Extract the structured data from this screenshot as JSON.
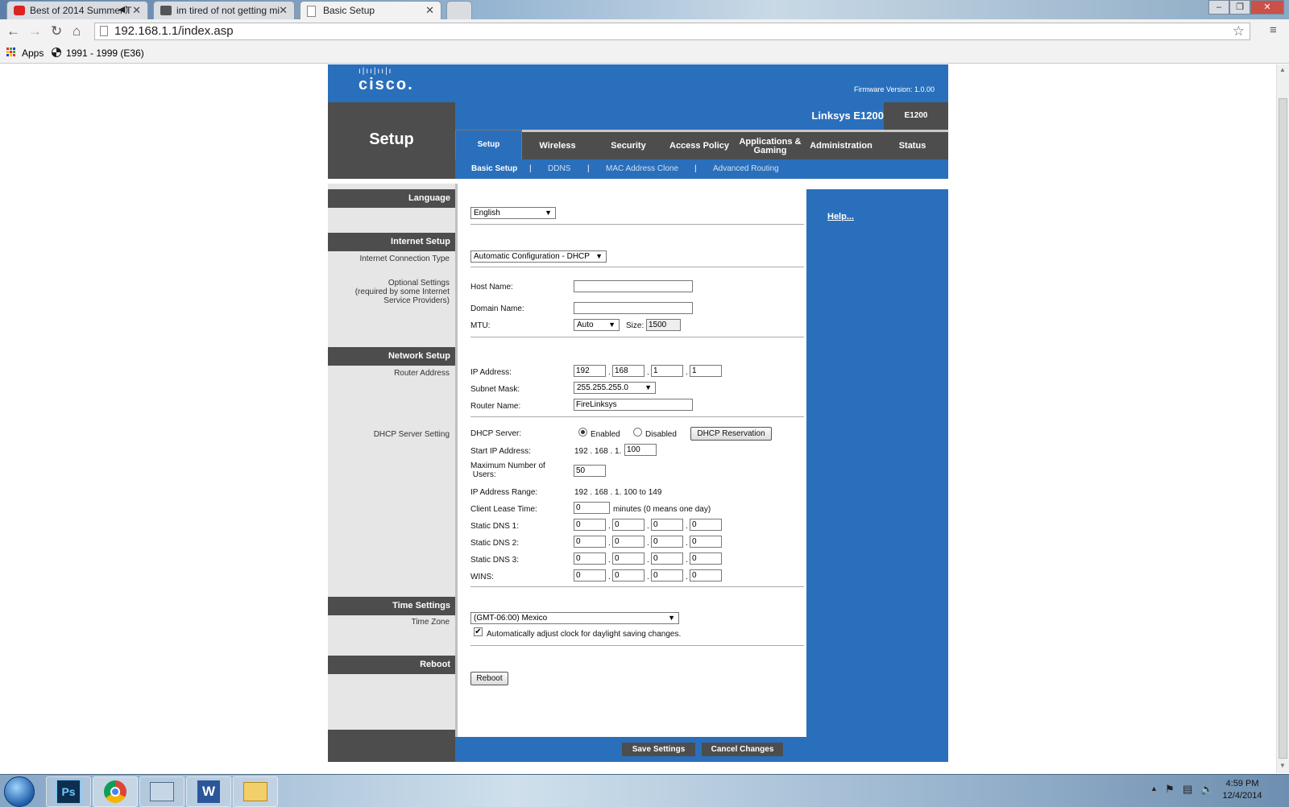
{
  "browser": {
    "tabs": [
      {
        "title": "Best of 2014 Summer T"
      },
      {
        "title": "im tired of not getting mi"
      },
      {
        "title": "Basic Setup"
      }
    ],
    "url": "192.168.1.1/index.asp",
    "bookmarks": [
      {
        "label": "Apps"
      },
      {
        "label": "1991 - 1999 (E36)"
      }
    ]
  },
  "router": {
    "brand": "cisco.",
    "firmware": "Firmware Version: 1.0.00",
    "page_title": "Setup",
    "model_name": "Linksys E1200",
    "model_code": "E1200",
    "main_nav": [
      {
        "label": "Setup"
      },
      {
        "label": "Wireless"
      },
      {
        "label": "Security"
      },
      {
        "label": "Access Policy"
      },
      {
        "label": "Applications & Gaming"
      },
      {
        "label": "Administration"
      },
      {
        "label": "Status"
      }
    ],
    "sub_nav": [
      {
        "label": "Basic Setup"
      },
      {
        "label": "DDNS"
      },
      {
        "label": "MAC Address Clone"
      },
      {
        "label": "Advanced Routing"
      }
    ],
    "help_link": "Help...",
    "sections": {
      "language": "Language",
      "internet_setup": "Internet Setup",
      "network_setup": "Network Setup",
      "time_settings": "Time Settings",
      "reboot": "Reboot"
    },
    "left_labels": {
      "connection_type": "Internet Connection Type",
      "optional": "Optional Settings\n(required by some Internet\nService Providers)",
      "router_address": "Router Address",
      "dhcp_setting": "DHCP Server Setting",
      "time_zone": "Time Zone"
    },
    "language_value": "English",
    "connection_type_value": "Automatic Configuration - DHCP",
    "optional": {
      "host_name_label": "Host Name:",
      "host_name_value": "",
      "domain_name_label": "Domain Name:",
      "domain_name_value": "",
      "mtu_label": "MTU:",
      "mtu_value": "Auto",
      "size_label": "Size:",
      "size_value": "1500"
    },
    "router_addr": {
      "ip_label": "IP Address:",
      "ip": [
        "192",
        "168",
        "1",
        "1"
      ],
      "subnet_label": "Subnet Mask:",
      "subnet_value": "255.255.255.0",
      "name_label": "Router Name:",
      "name_value": "FireLinksys"
    },
    "dhcp": {
      "server_label": "DHCP Server:",
      "enabled_label": "Enabled",
      "disabled_label": "Disabled",
      "reservation_button": "DHCP Reservation",
      "start_label": "Start IP  Address:",
      "start_prefix": "192 . 168 . 1.",
      "start_value": "100",
      "max_label_1": "Maximum Number of",
      "max_label_2": " Users:",
      "max_value": "50",
      "range_label": "IP Address Range:",
      "range_value": "192 . 168 . 1. 100 to 149",
      "lease_label": "Client Lease Time:",
      "lease_value": "0",
      "lease_suffix": "minutes (0 means one day)",
      "dns1_label": "Static DNS 1:",
      "dns2_label": "Static DNS 2:",
      "dns3_label": "Static DNS 3:",
      "wins_label": "WINS:",
      "dns1": [
        "0",
        "0",
        "0",
        "0"
      ],
      "dns2": [
        "0",
        "0",
        "0",
        "0"
      ],
      "dns3": [
        "0",
        "0",
        "0",
        "0"
      ],
      "wins": [
        "0",
        "0",
        "0",
        "0"
      ]
    },
    "time": {
      "zone_value": "(GMT-06:00) Mexico",
      "dst_label": "Automatically adjust clock for daylight saving changes."
    },
    "reboot_button": "Reboot",
    "save_button": "Save Settings",
    "cancel_button": "Cancel Changes"
  },
  "taskbar": {
    "time": "4:59 PM",
    "date": "12/4/2014",
    "apps": [
      {
        "icon": "start-orb-icon"
      },
      {
        "icon": "photoshop-icon",
        "label": "Ps"
      },
      {
        "icon": "chrome-icon"
      },
      {
        "icon": "network-icon"
      },
      {
        "icon": "word-icon",
        "label": "W"
      },
      {
        "icon": "folder-icon"
      }
    ]
  },
  "colors": {
    "brand_blue": "#2a6fbb",
    "dark_gray": "#4d4d4d",
    "light_gray": "#e6e6e6"
  }
}
